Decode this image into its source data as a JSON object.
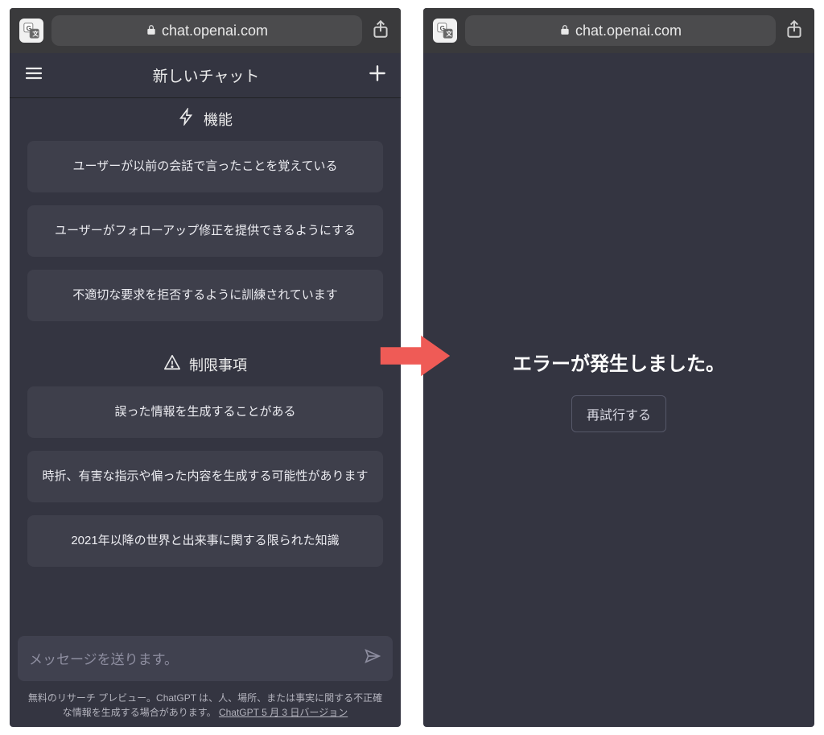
{
  "chrome": {
    "url": "chat.openai.com"
  },
  "left": {
    "header_title": "新しいチャット",
    "section_capabilities": {
      "title": "機能",
      "cards": [
        "ユーザーが以前の会話で言ったことを覚えている",
        "ユーザーがフォローアップ修正を提供できるようにする",
        "不適切な要求を拒否するように訓練されています"
      ]
    },
    "section_limitations": {
      "title": "制限事項",
      "cards": [
        "誤った情報を生成することがある",
        "時折、有害な指示や偏った内容を生成する可能性があります",
        "2021年以降の世界と出来事に関する限られた知識"
      ]
    },
    "composer_placeholder": "メッセージを送ります。",
    "footer_pre": "無料のリサーチ プレビュー。ChatGPT は、人、場所、または事実に関する不正確な情報を生成する場合があります。",
    "footer_link": "ChatGPT 5 月 3 日バージョン"
  },
  "right": {
    "error_title": "エラーが発生しました。",
    "retry_label": "再試行する"
  }
}
